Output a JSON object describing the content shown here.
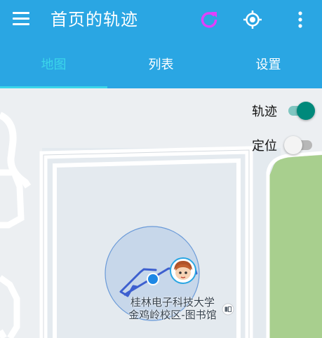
{
  "appbar": {
    "title": "首页的轨迹",
    "menu_icon": "hamburger-menu-icon",
    "refresh_icon": "refresh-icon",
    "locate_icon": "gps-locate-icon",
    "overflow_icon": "more-vert-icon",
    "background_color": "#2aa6e3",
    "refresh_color": "#e040fb"
  },
  "tabs": [
    {
      "label": "地图",
      "active": true
    },
    {
      "label": "列表",
      "active": false
    },
    {
      "label": "设置",
      "active": false
    }
  ],
  "map": {
    "switches": [
      {
        "label": "轨迹",
        "on": true
      },
      {
        "label": "定位",
        "on": false
      }
    ],
    "poi": {
      "line1": "桂林电子科技大学",
      "line2": "金鸡岭校区-图书馆",
      "icon": "library-poi-icon"
    },
    "avatar_icon": "user-avatar-icon",
    "location_dot_icon": "current-location-dot-icon"
  }
}
